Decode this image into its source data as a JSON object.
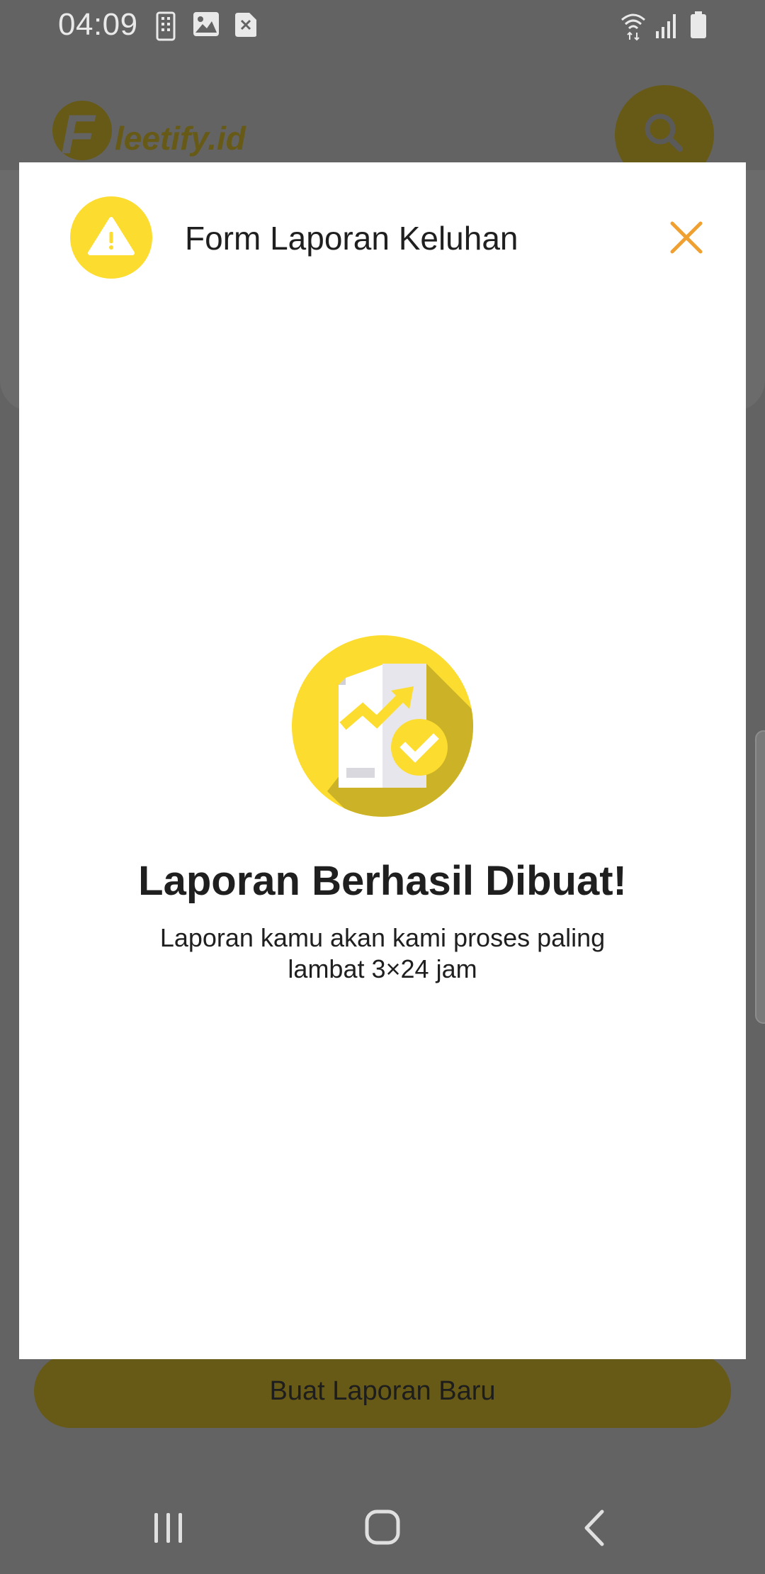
{
  "status_bar": {
    "time": "04:09",
    "notification_icons": [
      "sim-card-icon",
      "image-icon",
      "blocked-icon"
    ],
    "system_icons": [
      "wifi-icon",
      "signal-icon",
      "battery-icon"
    ]
  },
  "background_app": {
    "logo_mark": "F",
    "logo_text": "leetify.id",
    "new_report_button": "Buat Laporan Baru",
    "brand_color": "#fcdc2f"
  },
  "modal": {
    "title": "Form Laporan Keluhan",
    "header_icon": "warning-icon",
    "close_icon": "close-icon",
    "illustration": "report-success-icon",
    "success_title": "Laporan Berhasil Dibuat!",
    "success_message": "Laporan kamu akan kami proses paling lambat 3×24 jam",
    "accent_color": "#f0a030"
  },
  "nav_bar": {
    "buttons": [
      "recent-apps-icon",
      "home-icon",
      "back-icon"
    ]
  }
}
